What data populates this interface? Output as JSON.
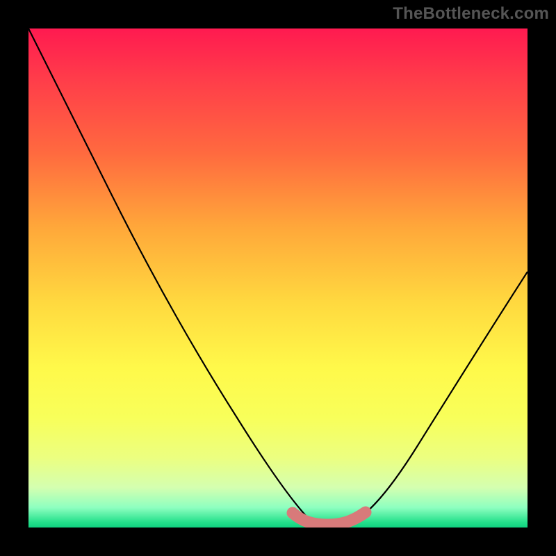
{
  "watermark": "TheBottleneck.com",
  "chart_data": {
    "type": "line",
    "title": "",
    "xlabel": "",
    "ylabel": "",
    "xlim": [
      0,
      100
    ],
    "ylim": [
      0,
      100
    ],
    "grid": false,
    "legend": false,
    "gradient_stops": [
      {
        "pos": 0,
        "color": "#ff1a50"
      },
      {
        "pos": 25,
        "color": "#ff6a3f"
      },
      {
        "pos": 55,
        "color": "#ffd93f"
      },
      {
        "pos": 78,
        "color": "#f8ff5a"
      },
      {
        "pos": 96,
        "color": "#8effc0"
      },
      {
        "pos": 100,
        "color": "#10d080"
      }
    ],
    "series": [
      {
        "name": "bottleneck-curve",
        "color": "#000000",
        "points": [
          {
            "x": 0,
            "y": 100
          },
          {
            "x": 10,
            "y": 80
          },
          {
            "x": 20,
            "y": 60
          },
          {
            "x": 30,
            "y": 42
          },
          {
            "x": 40,
            "y": 25
          },
          {
            "x": 48,
            "y": 10
          },
          {
            "x": 53,
            "y": 3
          },
          {
            "x": 58,
            "y": 0.8
          },
          {
            "x": 63,
            "y": 0.8
          },
          {
            "x": 68,
            "y": 3
          },
          {
            "x": 76,
            "y": 14
          },
          {
            "x": 85,
            "y": 30
          },
          {
            "x": 93,
            "y": 44
          },
          {
            "x": 100,
            "y": 56
          }
        ]
      },
      {
        "name": "bottleneck-band",
        "color": "#d87a7a",
        "points": [
          {
            "x": 53,
            "y": 3
          },
          {
            "x": 55,
            "y": 1.5
          },
          {
            "x": 58,
            "y": 0.8
          },
          {
            "x": 61,
            "y": 0.8
          },
          {
            "x": 64,
            "y": 1.4
          },
          {
            "x": 67,
            "y": 3
          }
        ]
      }
    ]
  }
}
